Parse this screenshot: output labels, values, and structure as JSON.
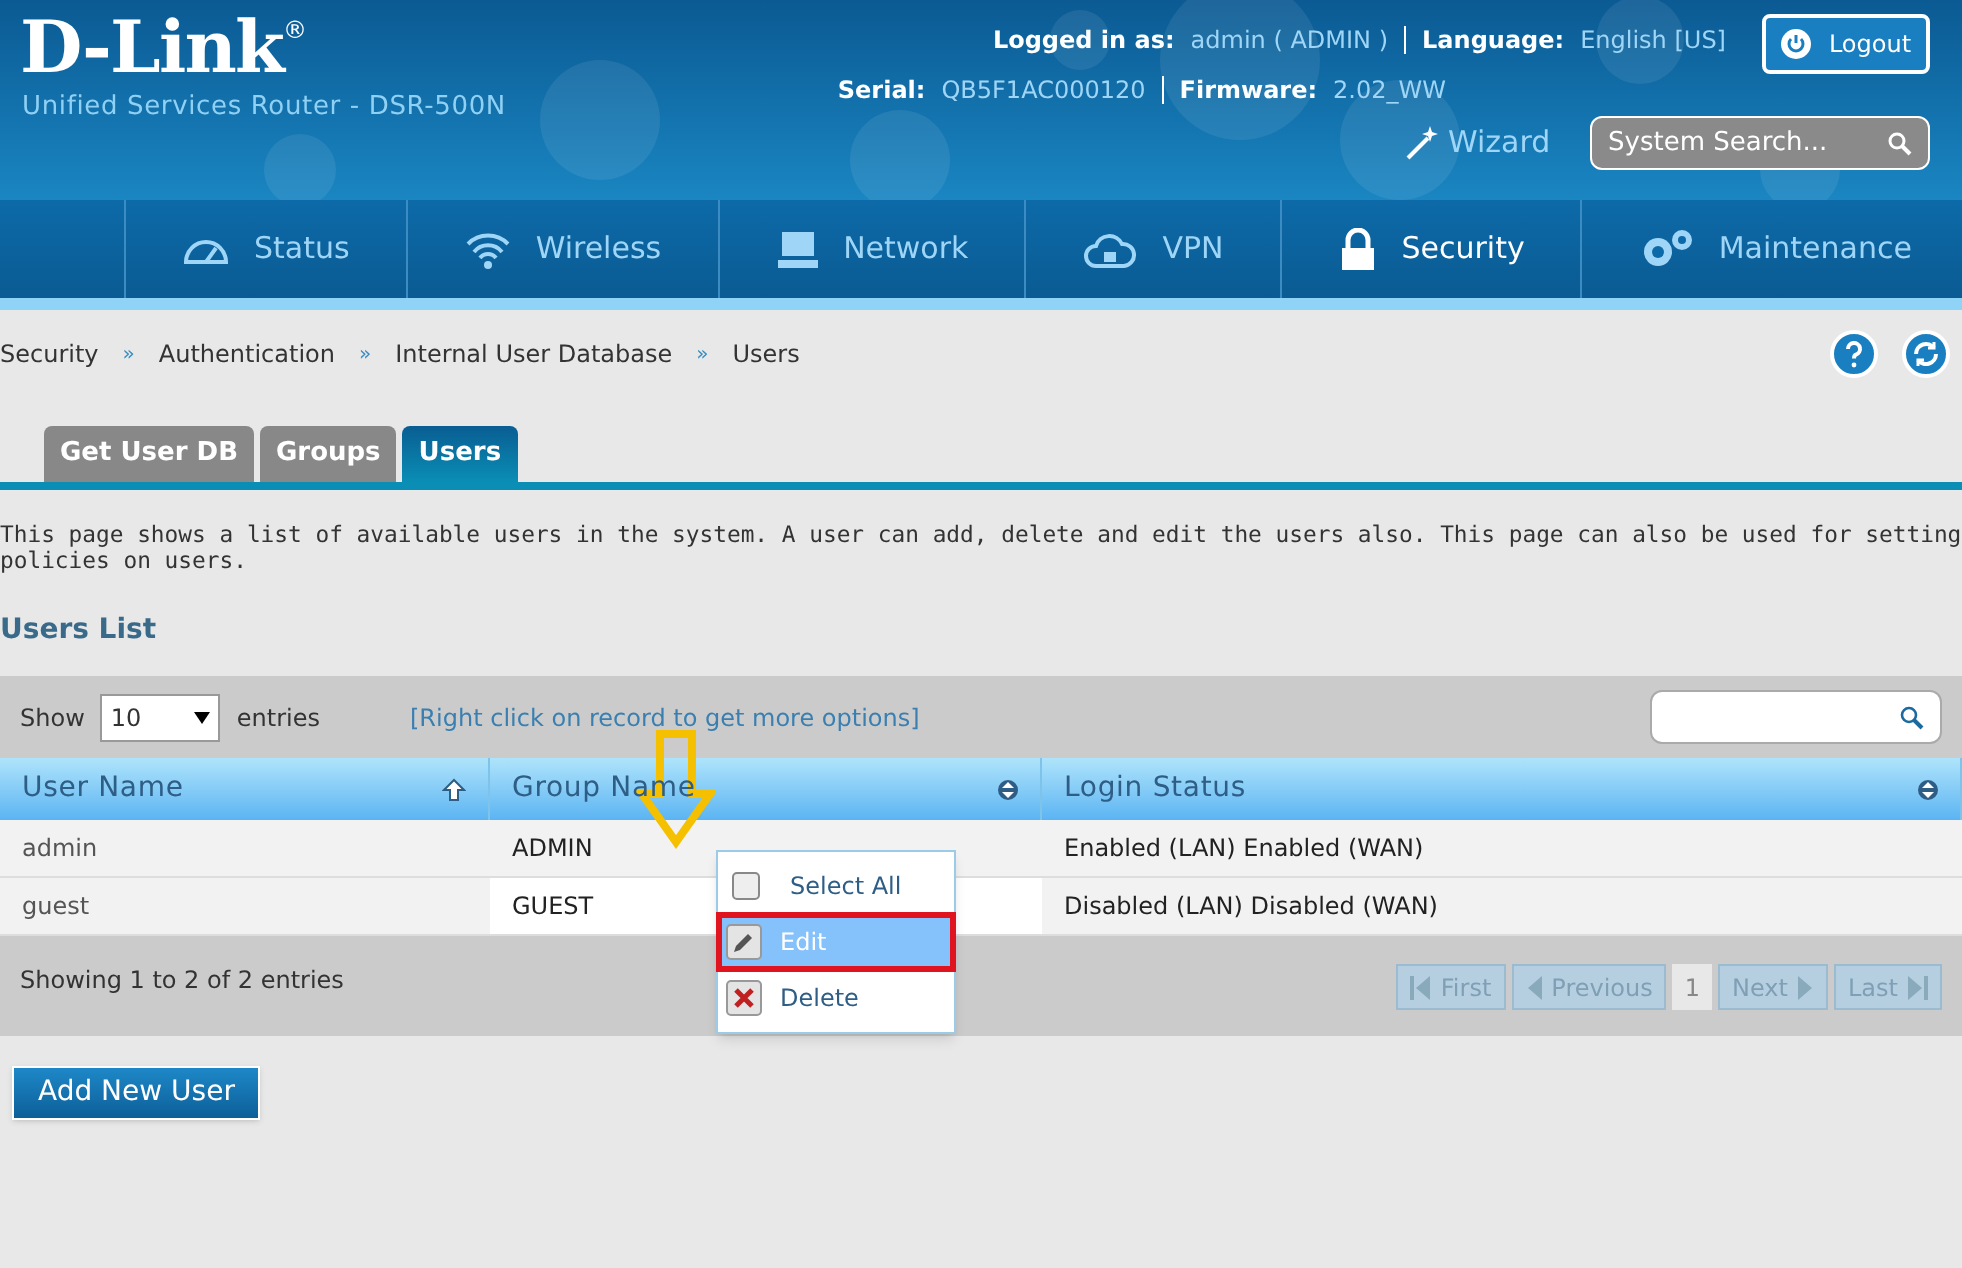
{
  "header": {
    "logo": "D-Link",
    "logo_mark": "®",
    "product": "Unified Services Router - DSR-500N",
    "logged_in_label": "Logged in as:",
    "logged_in_value": "admin ( ADMIN )",
    "language_label": "Language:",
    "language_value": "English [US]",
    "logout": "Logout",
    "serial_label": "Serial:",
    "serial_value": "QB5F1AC000120",
    "firmware_label": "Firmware:",
    "firmware_value": "2.02_WW",
    "wizard": "Wizard",
    "search_placeholder": "System Search..."
  },
  "nav": [
    {
      "label": "Status",
      "selected": false
    },
    {
      "label": "Wireless",
      "selected": false
    },
    {
      "label": "Network",
      "selected": false
    },
    {
      "label": "VPN",
      "selected": false
    },
    {
      "label": "Security",
      "selected": true
    },
    {
      "label": "Maintenance",
      "selected": false
    }
  ],
  "breadcrumb": [
    "Security",
    "Authentication",
    "Internal User Database",
    "Users"
  ],
  "breadcrumb_separator": "»",
  "tabs": [
    {
      "label": "Get User DB",
      "selected": false
    },
    {
      "label": "Groups",
      "selected": false
    },
    {
      "label": "Users",
      "selected": true
    }
  ],
  "description": "This page shows a list of available users in the system. A user can add, delete and edit the users also. This page can also be used for setting policies on users.",
  "list_title": "Users List",
  "table": {
    "show_label": "Show",
    "show_value": "10",
    "entries_label": "entries",
    "hint": "[Right click on record to get more options]",
    "columns": [
      {
        "label": "User Name",
        "kind": "sorted"
      },
      {
        "label": "Group Name",
        "kind": "sortable"
      },
      {
        "label": "Login Status",
        "kind": "sortable"
      }
    ],
    "rows": [
      [
        "admin",
        "ADMIN",
        "Enabled (LAN) Enabled (WAN)"
      ],
      [
        "guest",
        "GUEST",
        "Disabled (LAN) Disabled (WAN)"
      ]
    ],
    "info": "Showing 1 to 2 of 2 entries",
    "pagination": [
      {
        "label": "First",
        "kind": "first",
        "disabled": true
      },
      {
        "label": "Previous",
        "kind": "prev",
        "disabled": true
      },
      {
        "label": "1",
        "kind": "page"
      },
      {
        "label": "Next",
        "kind": "next",
        "disabled": true
      },
      {
        "label": "Last",
        "kind": "last",
        "disabled": true
      }
    ]
  },
  "context_menu": [
    {
      "label": "Select All",
      "kind": "checkbox",
      "checked": false,
      "highlighted": false
    },
    {
      "label": "Edit",
      "kind": "edit",
      "highlighted": true
    },
    {
      "label": "Delete",
      "kind": "delete",
      "highlighted": false
    }
  ],
  "add_button": "Add New User"
}
